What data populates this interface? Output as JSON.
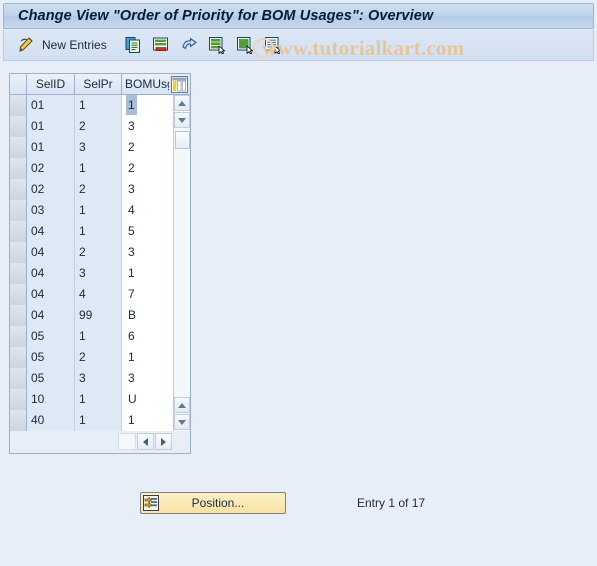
{
  "window": {
    "title": "Change View \"Order of Priority for BOM Usages\": Overview"
  },
  "toolbar": {
    "new_entries_label": "New Entries",
    "icons": [
      {
        "name": "edit-pencil-icon"
      },
      {
        "name": "copy-icon"
      },
      {
        "name": "delete-row-icon"
      },
      {
        "name": "undo-icon"
      },
      {
        "name": "select-all-icon"
      },
      {
        "name": "deselect-all-icon"
      },
      {
        "name": "variant-icon"
      }
    ]
  },
  "watermark": {
    "text": "www.tutorialkart.com"
  },
  "table": {
    "columns": [
      "SelID",
      "SelPr",
      "BOMUsg"
    ],
    "config_icon": "table-settings-icon",
    "focused_cell": {
      "row": 0,
      "col": 2
    },
    "rows": [
      {
        "selid": "01",
        "selpr": "1",
        "bomusg": "1"
      },
      {
        "selid": "01",
        "selpr": "2",
        "bomusg": "3"
      },
      {
        "selid": "01",
        "selpr": "3",
        "bomusg": "2"
      },
      {
        "selid": "02",
        "selpr": "1",
        "bomusg": "2"
      },
      {
        "selid": "02",
        "selpr": "2",
        "bomusg": "3"
      },
      {
        "selid": "03",
        "selpr": "1",
        "bomusg": "4"
      },
      {
        "selid": "04",
        "selpr": "1",
        "bomusg": "5"
      },
      {
        "selid": "04",
        "selpr": "2",
        "bomusg": "3"
      },
      {
        "selid": "04",
        "selpr": "3",
        "bomusg": "1"
      },
      {
        "selid": "04",
        "selpr": "4",
        "bomusg": "7"
      },
      {
        "selid": "04",
        "selpr": "99",
        "bomusg": "B"
      },
      {
        "selid": "05",
        "selpr": "1",
        "bomusg": "6"
      },
      {
        "selid": "05",
        "selpr": "2",
        "bomusg": "1"
      },
      {
        "selid": "05",
        "selpr": "3",
        "bomusg": "3"
      },
      {
        "selid": "10",
        "selpr": "1",
        "bomusg": "U"
      },
      {
        "selid": "40",
        "selpr": "1",
        "bomusg": "1"
      }
    ]
  },
  "footer": {
    "position_label": "Position...",
    "position_icon": "position-icon",
    "entry_status": "Entry 1 of 17"
  },
  "colors": {
    "page_background": "#e8eef7",
    "title_bar": "#bfd3ec",
    "watermark": "#e8c49a",
    "button_yellow": "#f7e3a4",
    "cell_focus": "#a8bed8"
  }
}
